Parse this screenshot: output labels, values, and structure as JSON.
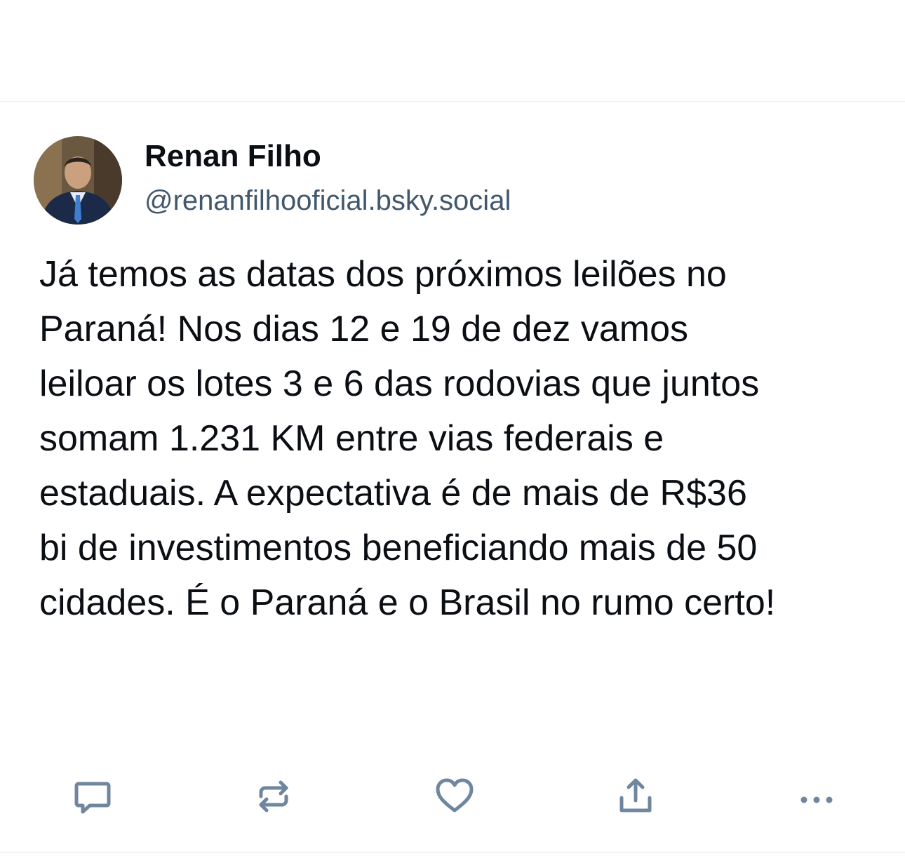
{
  "post": {
    "author": {
      "name": "Renan Filho",
      "handle": "@renanfilhooficial.bsky.social"
    },
    "text": "Já temos as datas dos próximos leilões no\nParaná! Nos dias 12 e 19 de dez vamos\nleiloar os lotes 3 e 6 das rodovias que juntos\nsomam 1.231 KM entre vias federais e\nestaduais. A expectativa é de mais de R$36\nbi de investimentos beneficiando mais de 50\ncidades. É o Paraná e o Brasil no rumo certo!"
  },
  "actions": [
    {
      "icon": "reply-icon"
    },
    {
      "icon": "repost-icon"
    },
    {
      "icon": "like-icon"
    },
    {
      "icon": "share-icon"
    },
    {
      "icon": "more-options-icon"
    }
  ],
  "colors": {
    "text": "#0b0f14",
    "handle": "#42576c",
    "icon": "#6f869f"
  }
}
